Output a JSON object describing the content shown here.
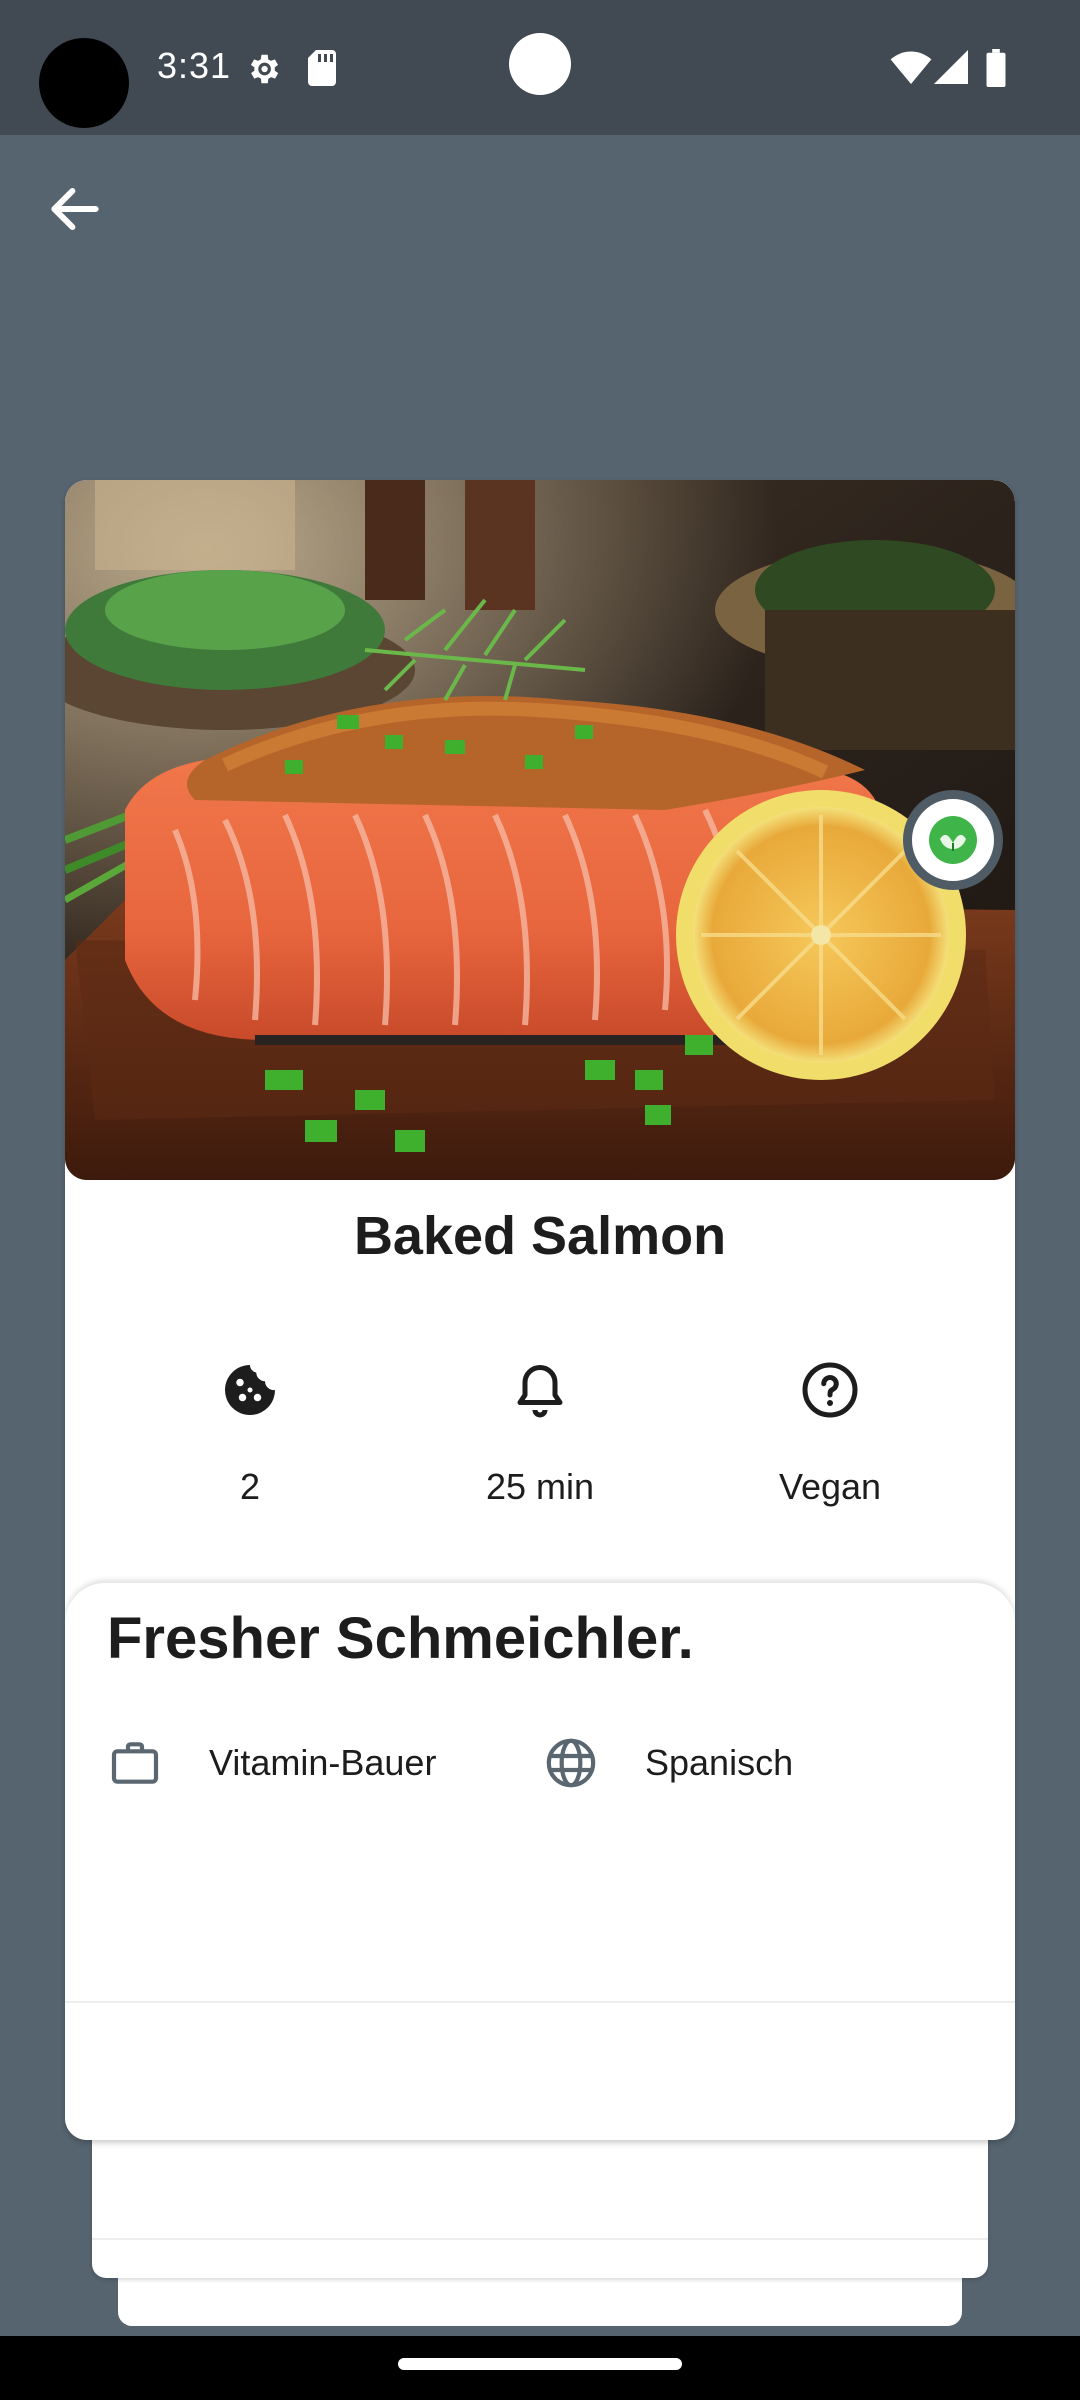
{
  "status_bar": {
    "time": "3:31",
    "icons": [
      "gear-icon",
      "sd-card-icon",
      "wifi-icon",
      "signal-icon",
      "battery-icon"
    ]
  },
  "toolbar": {
    "back_icon": "arrow-left-icon"
  },
  "recipe": {
    "title": "Baked Salmon",
    "badge_icon": "vegan-leaf-icon",
    "stats": [
      {
        "icon": "cookie-icon",
        "label": "2"
      },
      {
        "icon": "bell-icon",
        "label": "25 min"
      },
      {
        "icon": "help-circle-icon",
        "label": "Vegan"
      }
    ]
  },
  "info": {
    "title": "Fresher Schmeichler.",
    "category": {
      "icon": "briefcase-icon",
      "label": "Vitamin-Bauer"
    },
    "cuisine": {
      "icon": "globe-icon",
      "label": "Spanisch"
    }
  },
  "colors": {
    "background": "#566470",
    "status_bar": "#414a52",
    "card": "#ffffff",
    "text": "#1d1d1d",
    "badge_green": "#3fb549"
  }
}
